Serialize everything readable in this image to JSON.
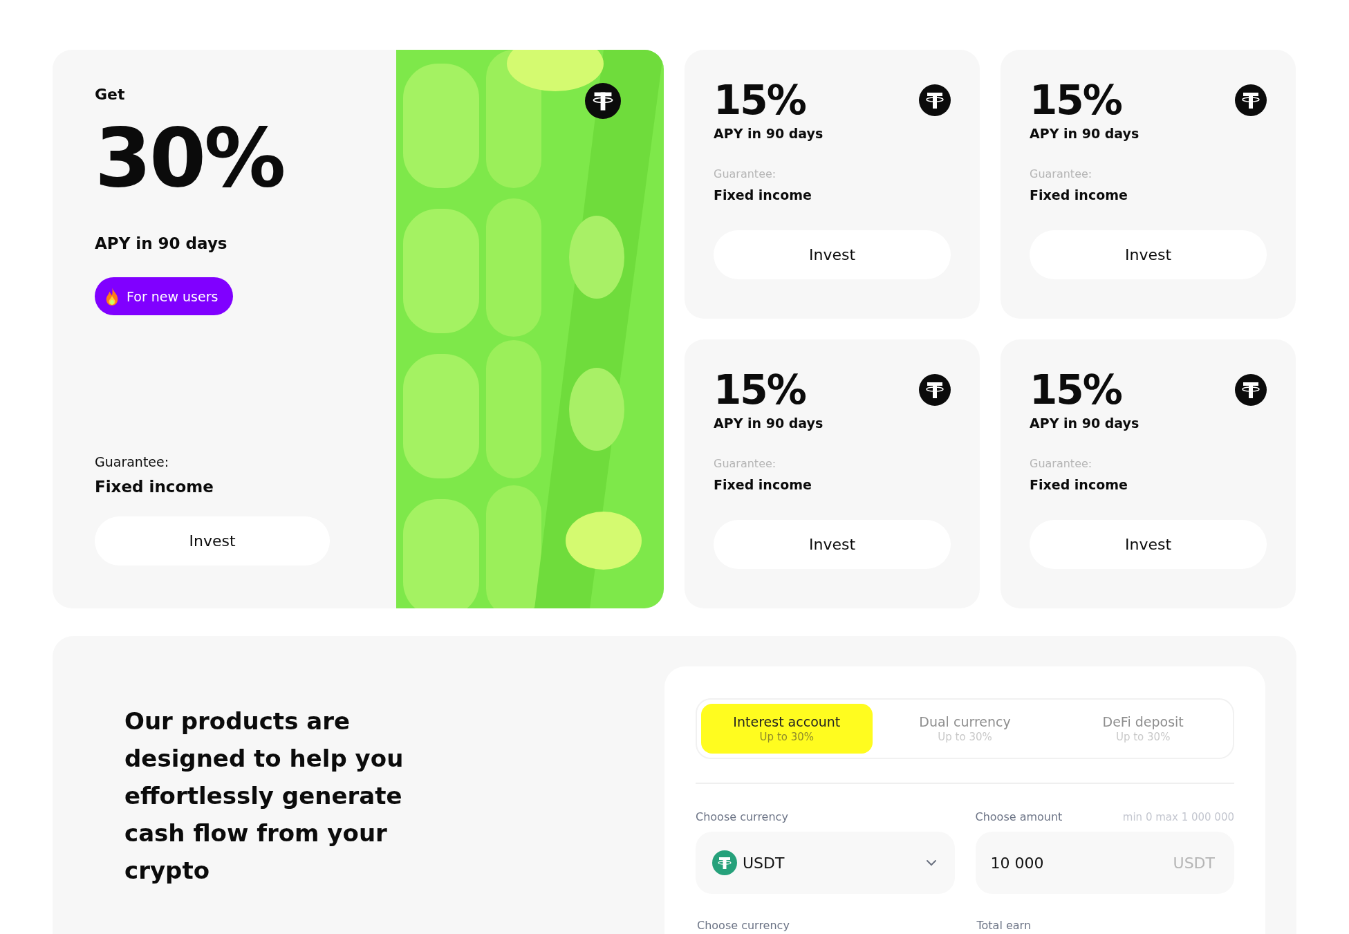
{
  "promo": {
    "label": "Get",
    "rate": "30%",
    "period": "APY in 90 days",
    "badge": "For new users",
    "guarantee_label": "Guarantee:",
    "guarantee": "Fixed income",
    "button": "Invest"
  },
  "offers": [
    {
      "rate": "15%",
      "period": "APY in 90 days",
      "guarantee_label": "Guarantee:",
      "guarantee": "Fixed income",
      "button": "Invest"
    },
    {
      "rate": "15%",
      "period": "APY in 90 days",
      "guarantee_label": "Guarantee:",
      "guarantee": "Fixed income",
      "button": "Invest"
    },
    {
      "rate": "15%",
      "period": "APY in 90 days",
      "guarantee_label": "Guarantee:",
      "guarantee": "Fixed income",
      "button": "Invest"
    },
    {
      "rate": "15%",
      "period": "APY in 90 days",
      "guarantee_label": "Guarantee:",
      "guarantee": "Fixed income",
      "button": "Invest"
    }
  ],
  "products": {
    "heading": "Our products are designed to help you effortlessly generate cash flow from your crypto",
    "tabs": [
      {
        "label": "Interest account",
        "sub": "Up to 30%",
        "selected": true
      },
      {
        "label": "Dual currency",
        "sub": "Up to 30%",
        "selected": false
      },
      {
        "label": "DeFi deposit",
        "sub": "Up to 30%",
        "selected": false
      }
    ],
    "currency": {
      "label": "Choose currency",
      "value": "USDT"
    },
    "amount": {
      "label": "Choose amount",
      "hint": "min 0 max 1 000 000",
      "value": "10 000",
      "unit": "USDT"
    },
    "next_labels": [
      "Choose currency",
      "Total earn"
    ]
  }
}
